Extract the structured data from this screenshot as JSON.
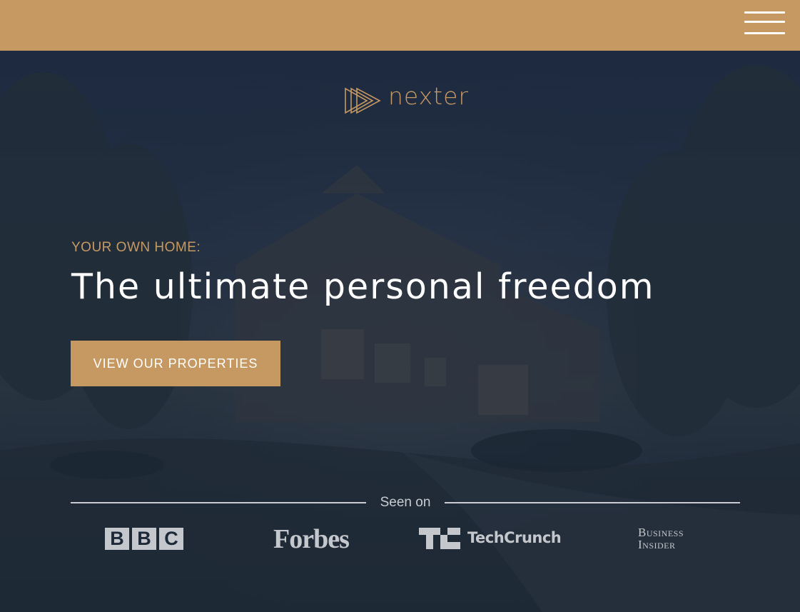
{
  "header": {
    "background_color": "#c69963",
    "menu_icon": "hamburger-menu-icon"
  },
  "hero": {
    "logo": {
      "icon": "triple-play-triangles-icon",
      "text": "nexter"
    },
    "eyebrow": "YOUR OWN HOME:",
    "headline": "The ultimate personal freedom",
    "cta_label": "VIEW OUR PROPERTIES",
    "accent_color": "#c69963"
  },
  "seen_on": {
    "label": "Seen on",
    "logos": [
      {
        "name": "BBC",
        "letters": [
          "B",
          "B",
          "C"
        ]
      },
      {
        "name": "Forbes"
      },
      {
        "name": "TechCrunch"
      },
      {
        "name": "Business Insider",
        "line1": "Business",
        "line2": "Insider"
      }
    ]
  }
}
